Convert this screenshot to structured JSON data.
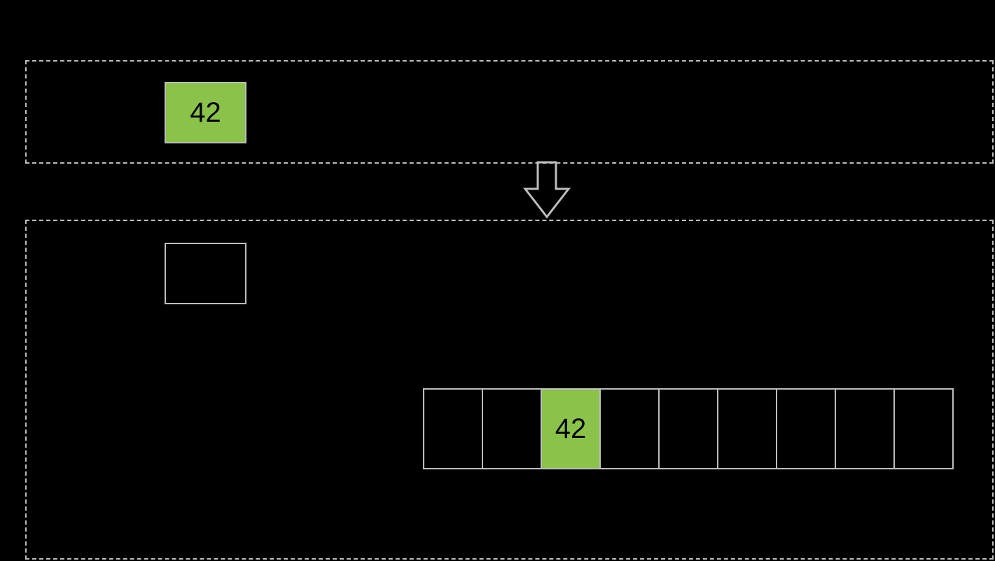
{
  "top_panel": {
    "value_cell": {
      "value": "42",
      "highlighted": true
    }
  },
  "bottom_panel": {
    "single_cell": {
      "value": "",
      "highlighted": false
    },
    "array": {
      "cells": [
        {
          "value": "",
          "highlighted": false
        },
        {
          "value": "",
          "highlighted": false
        },
        {
          "value": "42",
          "highlighted": true
        },
        {
          "value": "",
          "highlighted": false
        },
        {
          "value": "",
          "highlighted": false
        },
        {
          "value": "",
          "highlighted": false
        },
        {
          "value": "",
          "highlighted": false
        },
        {
          "value": "",
          "highlighted": false
        },
        {
          "value": "",
          "highlighted": false
        }
      ]
    }
  },
  "colors": {
    "highlight": "#8bc34a",
    "border": "#bdbdbd",
    "background": "#000000"
  }
}
